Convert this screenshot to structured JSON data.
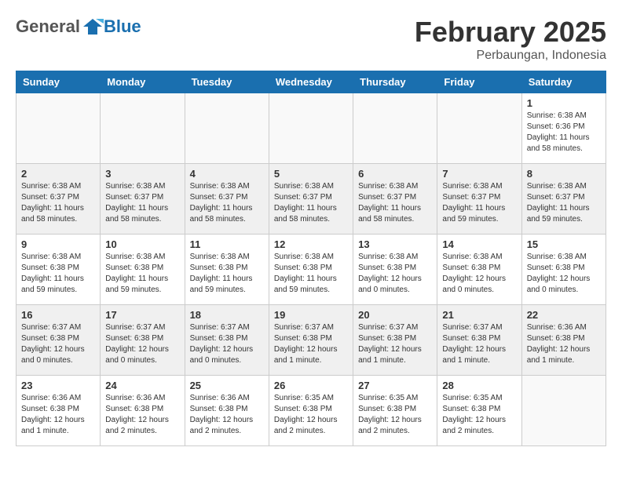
{
  "header": {
    "logo_general": "General",
    "logo_blue": "Blue",
    "month": "February 2025",
    "location": "Perbaungan, Indonesia"
  },
  "days_of_week": [
    "Sunday",
    "Monday",
    "Tuesday",
    "Wednesday",
    "Thursday",
    "Friday",
    "Saturday"
  ],
  "weeks": [
    [
      {
        "day": "",
        "info": ""
      },
      {
        "day": "",
        "info": ""
      },
      {
        "day": "",
        "info": ""
      },
      {
        "day": "",
        "info": ""
      },
      {
        "day": "",
        "info": ""
      },
      {
        "day": "",
        "info": ""
      },
      {
        "day": "1",
        "info": "Sunrise: 6:38 AM\nSunset: 6:36 PM\nDaylight: 11 hours and 58 minutes."
      }
    ],
    [
      {
        "day": "2",
        "info": "Sunrise: 6:38 AM\nSunset: 6:37 PM\nDaylight: 11 hours and 58 minutes."
      },
      {
        "day": "3",
        "info": "Sunrise: 6:38 AM\nSunset: 6:37 PM\nDaylight: 11 hours and 58 minutes."
      },
      {
        "day": "4",
        "info": "Sunrise: 6:38 AM\nSunset: 6:37 PM\nDaylight: 11 hours and 58 minutes."
      },
      {
        "day": "5",
        "info": "Sunrise: 6:38 AM\nSunset: 6:37 PM\nDaylight: 11 hours and 58 minutes."
      },
      {
        "day": "6",
        "info": "Sunrise: 6:38 AM\nSunset: 6:37 PM\nDaylight: 11 hours and 58 minutes."
      },
      {
        "day": "7",
        "info": "Sunrise: 6:38 AM\nSunset: 6:37 PM\nDaylight: 11 hours and 59 minutes."
      },
      {
        "day": "8",
        "info": "Sunrise: 6:38 AM\nSunset: 6:37 PM\nDaylight: 11 hours and 59 minutes."
      }
    ],
    [
      {
        "day": "9",
        "info": "Sunrise: 6:38 AM\nSunset: 6:38 PM\nDaylight: 11 hours and 59 minutes."
      },
      {
        "day": "10",
        "info": "Sunrise: 6:38 AM\nSunset: 6:38 PM\nDaylight: 11 hours and 59 minutes."
      },
      {
        "day": "11",
        "info": "Sunrise: 6:38 AM\nSunset: 6:38 PM\nDaylight: 11 hours and 59 minutes."
      },
      {
        "day": "12",
        "info": "Sunrise: 6:38 AM\nSunset: 6:38 PM\nDaylight: 11 hours and 59 minutes."
      },
      {
        "day": "13",
        "info": "Sunrise: 6:38 AM\nSunset: 6:38 PM\nDaylight: 12 hours and 0 minutes."
      },
      {
        "day": "14",
        "info": "Sunrise: 6:38 AM\nSunset: 6:38 PM\nDaylight: 12 hours and 0 minutes."
      },
      {
        "day": "15",
        "info": "Sunrise: 6:38 AM\nSunset: 6:38 PM\nDaylight: 12 hours and 0 minutes."
      }
    ],
    [
      {
        "day": "16",
        "info": "Sunrise: 6:37 AM\nSunset: 6:38 PM\nDaylight: 12 hours and 0 minutes."
      },
      {
        "day": "17",
        "info": "Sunrise: 6:37 AM\nSunset: 6:38 PM\nDaylight: 12 hours and 0 minutes."
      },
      {
        "day": "18",
        "info": "Sunrise: 6:37 AM\nSunset: 6:38 PM\nDaylight: 12 hours and 0 minutes."
      },
      {
        "day": "19",
        "info": "Sunrise: 6:37 AM\nSunset: 6:38 PM\nDaylight: 12 hours and 1 minute."
      },
      {
        "day": "20",
        "info": "Sunrise: 6:37 AM\nSunset: 6:38 PM\nDaylight: 12 hours and 1 minute."
      },
      {
        "day": "21",
        "info": "Sunrise: 6:37 AM\nSunset: 6:38 PM\nDaylight: 12 hours and 1 minute."
      },
      {
        "day": "22",
        "info": "Sunrise: 6:36 AM\nSunset: 6:38 PM\nDaylight: 12 hours and 1 minute."
      }
    ],
    [
      {
        "day": "23",
        "info": "Sunrise: 6:36 AM\nSunset: 6:38 PM\nDaylight: 12 hours and 1 minute."
      },
      {
        "day": "24",
        "info": "Sunrise: 6:36 AM\nSunset: 6:38 PM\nDaylight: 12 hours and 2 minutes."
      },
      {
        "day": "25",
        "info": "Sunrise: 6:36 AM\nSunset: 6:38 PM\nDaylight: 12 hours and 2 minutes."
      },
      {
        "day": "26",
        "info": "Sunrise: 6:35 AM\nSunset: 6:38 PM\nDaylight: 12 hours and 2 minutes."
      },
      {
        "day": "27",
        "info": "Sunrise: 6:35 AM\nSunset: 6:38 PM\nDaylight: 12 hours and 2 minutes."
      },
      {
        "day": "28",
        "info": "Sunrise: 6:35 AM\nSunset: 6:38 PM\nDaylight: 12 hours and 2 minutes."
      },
      {
        "day": "",
        "info": ""
      }
    ]
  ]
}
